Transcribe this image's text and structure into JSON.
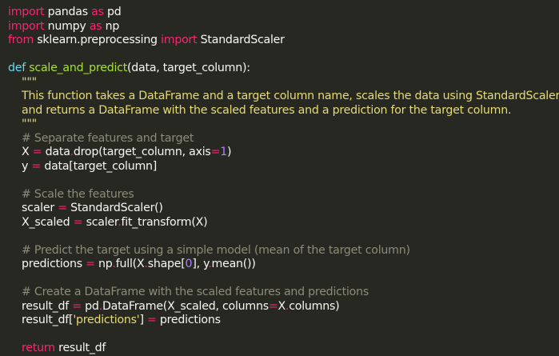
{
  "code": {
    "line1": {
      "kw1": "import",
      "t1": " pandas ",
      "kw2": "as",
      "t2": " pd"
    },
    "line2": {
      "kw1": "import",
      "t1": " numpy ",
      "kw2": "as",
      "t2": " np"
    },
    "line3": {
      "kw1": "from",
      "t1": " sklearn.preprocessing ",
      "kw2": "import",
      "t2": " StandardScaler"
    },
    "line5": {
      "kw": "def",
      "fn": "scale_and_predict",
      "t": "(data, target_column):"
    },
    "line6": {
      "doc": "    \"\"\""
    },
    "line7": {
      "doc": "    This function takes a DataFrame and a target column name, scales the data using StandardScaler,"
    },
    "line8": {
      "doc": "    and returns a DataFrame with the scaled features and a prediction for the target column."
    },
    "line9": {
      "doc": "    \"\"\""
    },
    "line10": {
      "cmt": "    # Separate features and target"
    },
    "line11": {
      "a": "    X ",
      "op1": "=",
      "b": " data",
      "op2": ".",
      "c": "drop(target_column, axis",
      "op3": "=",
      "num": "1",
      "d": ")"
    },
    "line12": {
      "a": "    y ",
      "op1": "=",
      "b": " data[target_column]"
    },
    "line14": {
      "cmt": "    # Scale the features"
    },
    "line15": {
      "a": "    scaler ",
      "op1": "=",
      "b": " StandardScaler()"
    },
    "line16": {
      "a": "    X_scaled ",
      "op1": "=",
      "b": " scaler",
      "op2": ".",
      "c": "fit_transform(X)"
    },
    "line18": {
      "cmt": "    # Predict the target using a simple model (mean of the target column)"
    },
    "line19": {
      "a": "    predictions ",
      "op1": "=",
      "b": " np",
      "op2": ".",
      "c": "full(X",
      "op3": ".",
      "d": "shape[",
      "num": "0",
      "e": "], y",
      "op4": ".",
      "f": "mean())"
    },
    "line21": {
      "cmt": "    # Create a DataFrame with the scaled features and predictions"
    },
    "line22": {
      "a": "    result_df ",
      "op1": "=",
      "b": " pd",
      "op2": ".",
      "c": "DataFrame(X_scaled, columns",
      "op3": "=",
      "d": "X",
      "op4": ".",
      "e": "columns)"
    },
    "line23": {
      "a": "    result_df[",
      "str": "'predictions'",
      "b": "] ",
      "op1": "=",
      "c": " predictions"
    },
    "line25": {
      "kw": "    return",
      "t": " result_df"
    }
  }
}
